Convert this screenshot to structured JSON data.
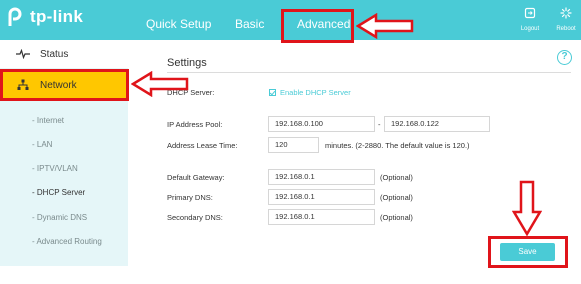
{
  "brand": {
    "logo_text": "tp-link"
  },
  "nav": {
    "tabs": [
      {
        "label": "Quick Setup"
      },
      {
        "label": "Basic"
      },
      {
        "label": "Advanced"
      }
    ],
    "logout_label": "Logout",
    "reboot_label": "Reboot"
  },
  "sidebar": {
    "items": [
      {
        "label": "Status",
        "icon": "pulse-icon"
      },
      {
        "label": "Network",
        "icon": "network-icon"
      }
    ],
    "subitems": [
      {
        "label": "- Internet"
      },
      {
        "label": "- LAN"
      },
      {
        "label": "- IPTV/VLAN"
      },
      {
        "label": "- DHCP Server"
      },
      {
        "label": "- Dynamic DNS"
      },
      {
        "label": "- Advanced Routing"
      }
    ]
  },
  "settings": {
    "title": "Settings",
    "dhcp_server_label": "DHCP Server:",
    "enable_dhcp_label": "Enable DHCP Server",
    "ip_pool_label": "IP Address Pool:",
    "ip_pool_start": "192.168.0.100",
    "ip_pool_sep": "-",
    "ip_pool_end": "192.168.0.122",
    "lease_label": "Address Lease Time:",
    "lease_value": "120",
    "lease_note": "minutes. (2-2880. The default value is 120.)",
    "gateway_label": "Default Gateway:",
    "gateway_value": "192.168.0.1",
    "primary_dns_label": "Primary DNS:",
    "primary_dns_value": "192.168.0.1",
    "secondary_dns_label": "Secondary DNS:",
    "secondary_dns_value": "192.168.0.1",
    "optional_label": "(Optional)",
    "save_label": "Save",
    "help_label": "?"
  },
  "colors": {
    "header": "#4acbd6",
    "sidebar_bg": "#e5f6f8",
    "active_item": "#ffc700",
    "annotation_red": "#e0141a"
  }
}
